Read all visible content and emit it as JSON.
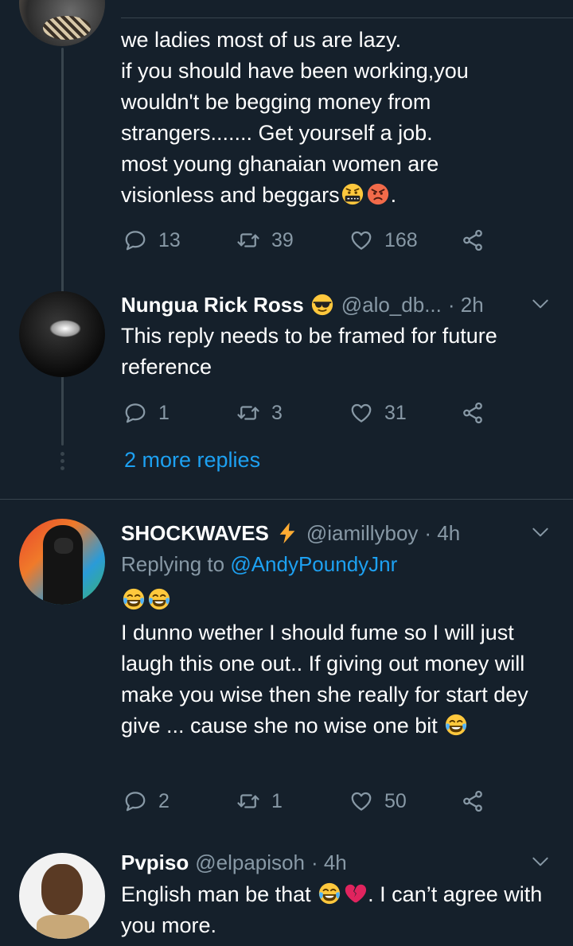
{
  "tweet1": {
    "text": "we ladies most of us are lazy.\nif you should have been working,you wouldn't be begging money from strangers....... Get yourself a job.\nmost young ghanaian women are visionless and beggars",
    "text_end": ".",
    "replies": "13",
    "retweets": "39",
    "likes": "168"
  },
  "reply1": {
    "name": "Nungua Rick Ross",
    "handle": "@alo_db...",
    "time": "· 2h",
    "text": "This reply needs to be framed for future reference",
    "replies": "1",
    "retweets": "3",
    "likes": "31"
  },
  "more_replies": "2 more replies",
  "reply2": {
    "name": "SHOCKWAVES",
    "handle": "@iamillyboy",
    "time": "· 4h",
    "replying_prefix": "Replying to",
    "replying_to": "@AndyPoundyJnr",
    "text": "I dunno wether I should fume so I will just laugh this one out.. If giving out money will make you wise then she really for start dey give ... cause she no wise one bit",
    "replies": "2",
    "retweets": "1",
    "likes": "50"
  },
  "reply3": {
    "name": "Pvpiso",
    "handle": "@elpapisoh",
    "time": "· 4h",
    "text_a": "English man be that",
    "text_b": ". I can’t agree with you more."
  },
  "colors": {
    "background": "#15202b",
    "divider": "#38444d",
    "secondary_text": "#8899a6",
    "link": "#1da1f2"
  },
  "icons": [
    "reply-icon",
    "retweet-icon",
    "like-icon",
    "share-icon",
    "chevron-down-icon",
    "sunglasses-emoji",
    "lightning-emoji",
    "laughing-emoji",
    "broken-heart-emoji",
    "angry-emoji",
    "cursing-emoji"
  ]
}
